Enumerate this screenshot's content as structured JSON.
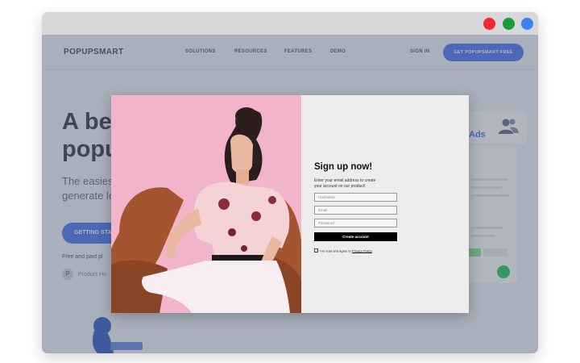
{
  "window": {
    "title_bar_buttons": [
      {
        "name": "close",
        "color": "#f5282d"
      },
      {
        "name": "minimize",
        "color": "#1d9a3c"
      },
      {
        "name": "maximize",
        "color": "#3e80f5"
      }
    ]
  },
  "site": {
    "logo": "POPUPSMART",
    "nav": [
      "SOLUTIONS",
      "RESOURCES",
      "FEATURES",
      "DEMO"
    ],
    "sign_in": "SIGN IN",
    "cta": "GET POPUPSMART FREE",
    "hero_heading_1": "A be",
    "hero_heading_2": "popu",
    "hero_sub_1": "The easiest",
    "hero_sub_2": "generate le",
    "hero_button": "GETTING STA",
    "hero_note": "Free and paid pl",
    "product_badge": "Product Hu",
    "ads_label": "Ads",
    "brand_color": "#4e7cf3"
  },
  "popup": {
    "title": "Sign up now!",
    "description": "Enter your email address to create your account on our product!",
    "username_placeholder": "Username",
    "email_placeholder": "Email",
    "password_placeholder": "Password",
    "submit_label": "Create account",
    "agree_text": "I've read and agree to ",
    "privacy_link": "Privacy Policy",
    "photo_bg": "#f1b4cb",
    "form_bg": "#ededee"
  }
}
